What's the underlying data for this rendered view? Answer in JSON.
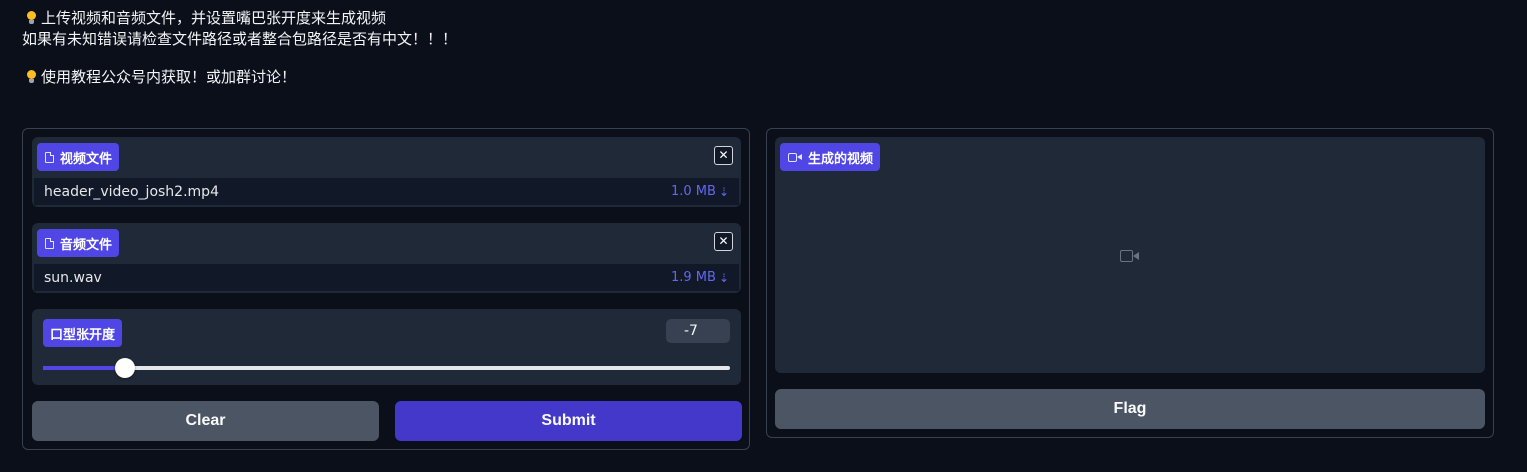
{
  "intro": {
    "line1": "上传视频和音频文件，并设置嘴巴张开度来生成视频",
    "line2": "如果有未知错误请检查文件路径或者整合包路径是否有中文！！！",
    "line3": "使用教程公众号内获取！或加群讨论！"
  },
  "inputs": {
    "video": {
      "label": "视频文件",
      "file_name": "header_video_josh2.mp4",
      "file_size": "1.0 MB",
      "icon": "file-icon",
      "clear_icon": "close-icon"
    },
    "audio": {
      "label": "音频文件",
      "file_name": "sun.wav",
      "file_size": "1.9 MB",
      "icon": "file-icon",
      "clear_icon": "close-icon"
    },
    "mouth": {
      "label": "口型张开度",
      "value": "-7",
      "value_fraction": 0.12
    }
  },
  "buttons": {
    "clear": "Clear",
    "submit": "Submit",
    "flag": "Flag"
  },
  "output": {
    "label": "生成的视频",
    "icon": "video-camera-icon"
  },
  "colors": {
    "accent": "#4f46e5",
    "background": "#0b0f19",
    "block": "#1f2937",
    "secondary_button": "#4b5563"
  }
}
